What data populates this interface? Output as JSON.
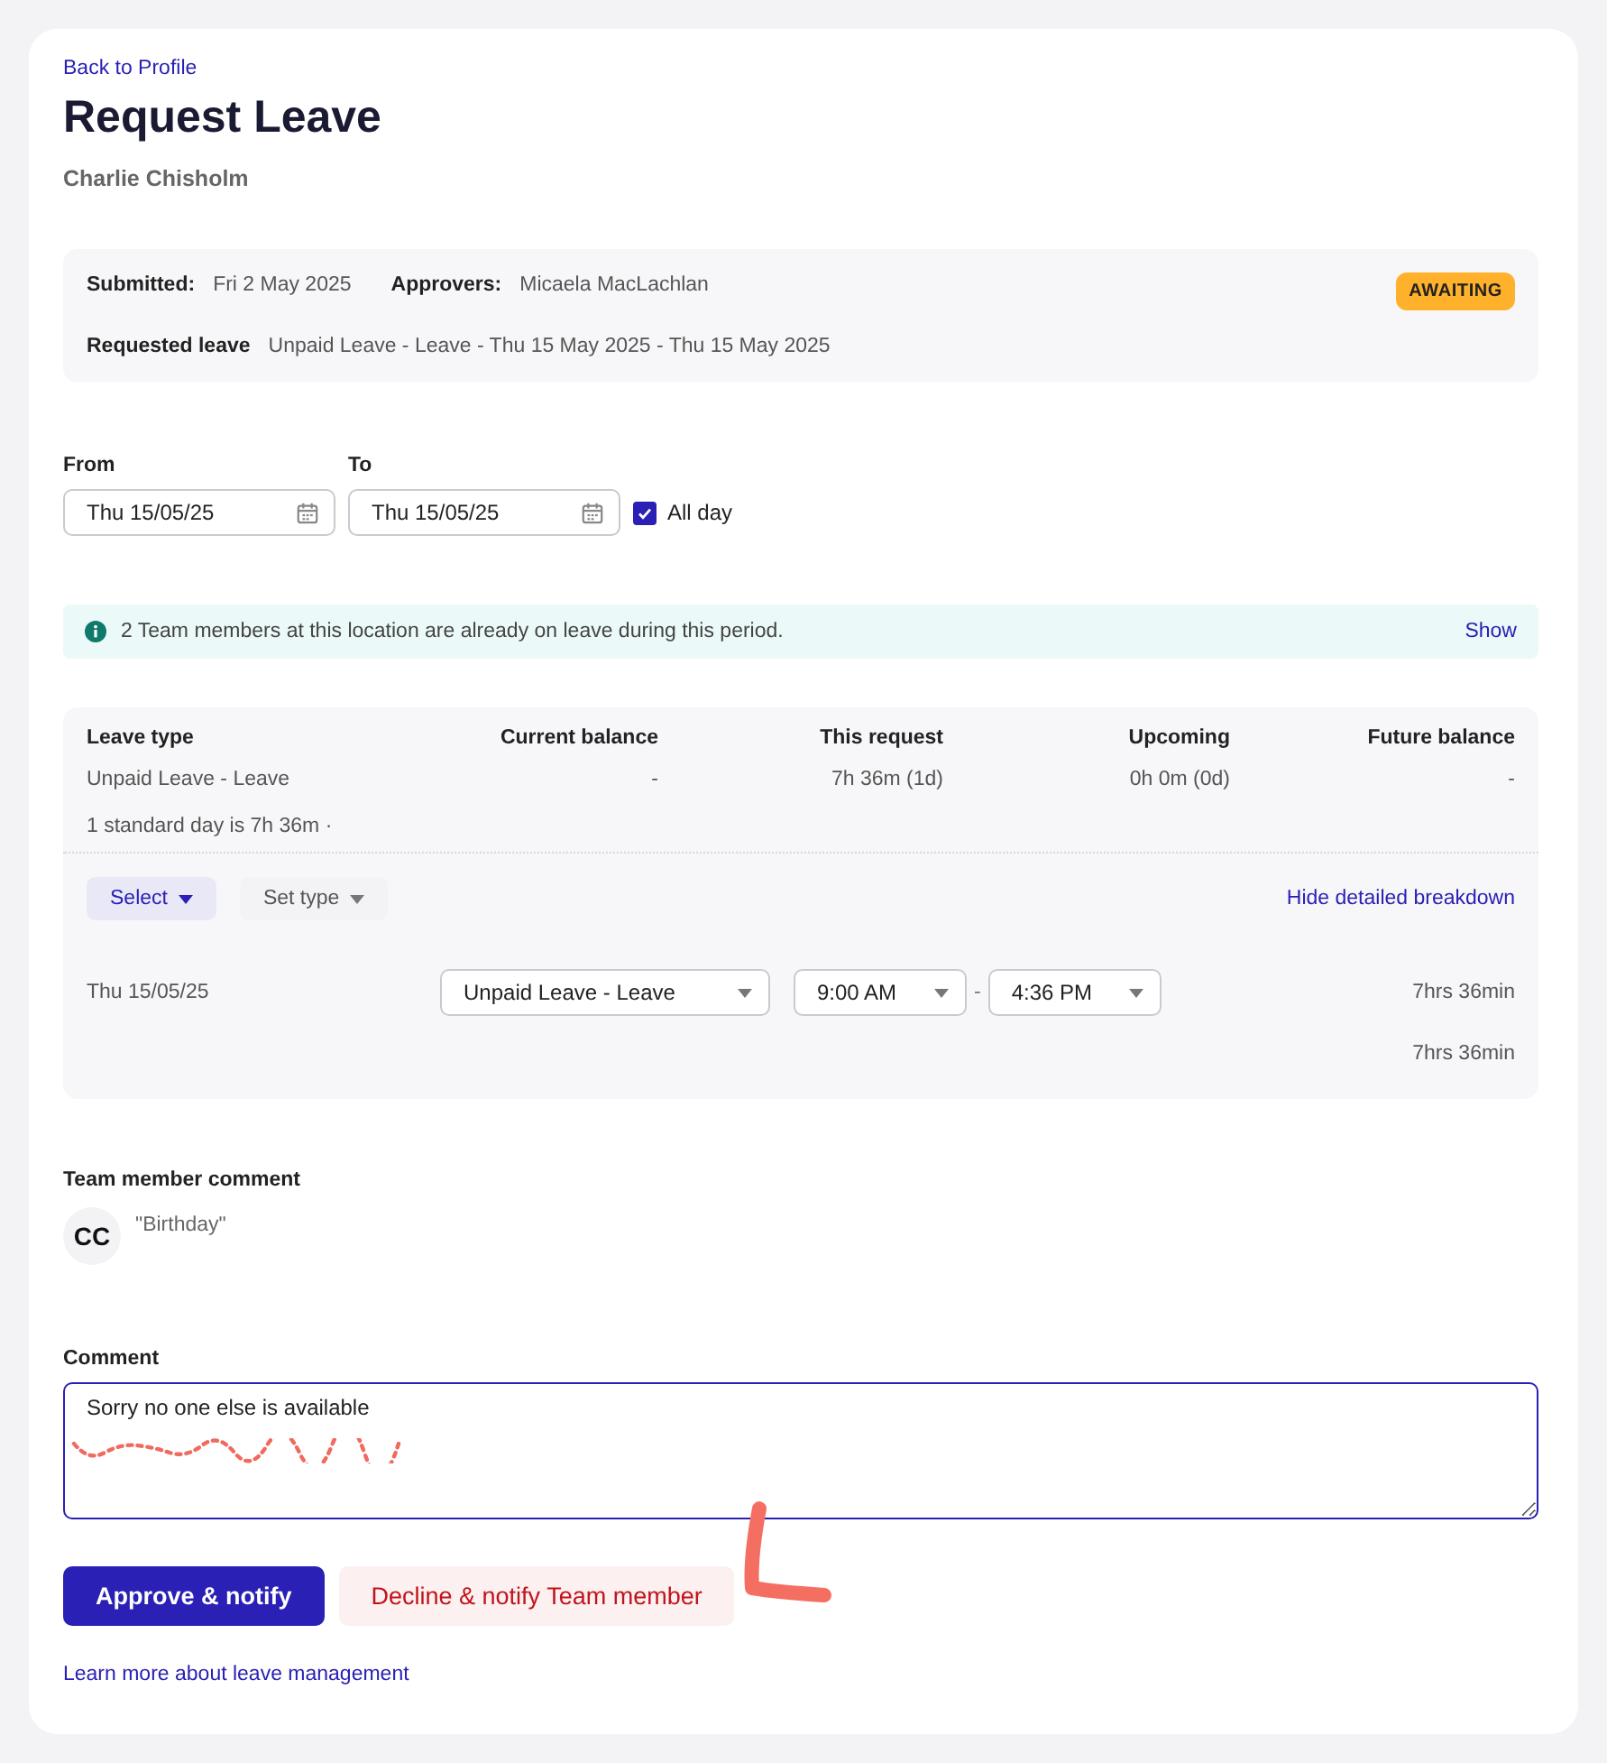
{
  "back_link": "Back to Profile",
  "title": "Request Leave",
  "employee": "Charlie Chisholm",
  "summary": {
    "fields": [
      {
        "label": "Submitted:",
        "value": "Fri 2 May 2025"
      },
      {
        "label": "Approvers:",
        "value": "Micaela MacLachlan"
      }
    ],
    "status": "AWAITING",
    "requested": {
      "label": "Requested leave",
      "value": "Unpaid Leave - Leave - Thu 15 May 2025 - Thu 15 May 2025"
    }
  },
  "dates": {
    "from": {
      "label": "From",
      "value": "Thu 15/05/25"
    },
    "to": {
      "label": "To",
      "value": "Thu 15/05/25"
    },
    "all_day": {
      "label": "All day",
      "checked": true
    }
  },
  "notice": {
    "text": "2 Team members at this location are already on leave during this period.",
    "action": "Show"
  },
  "breakdown": {
    "columns": [
      "Leave type",
      "Current balance",
      "This request",
      "Upcoming",
      "Future balance"
    ],
    "row": [
      "Unpaid Leave - Leave",
      "-",
      "7h 36m (1d)",
      "0h 0m (0d)",
      "-"
    ],
    "note": "1 standard day is 7h 36m ·",
    "select_button": "Select",
    "set_type_button": "Set type",
    "toggle_link": "Hide detailed breakdown",
    "days": [
      {
        "date": "Thu 15/05/25",
        "leave_type": "Unpaid Leave - Leave",
        "start": "9:00 AM",
        "separator": "-",
        "end": "4:36 PM",
        "duration": "7hrs 36min"
      }
    ],
    "total": "7hrs 36min"
  },
  "team_comment": {
    "label": "Team member comment",
    "initials": "CC",
    "text": "\"Birthday\""
  },
  "comment": {
    "label": "Comment",
    "value": "Sorry no one else is available"
  },
  "buttons": {
    "approve": "Approve & notify",
    "decline": "Decline & notify Team member"
  },
  "help_link": "Learn more about leave management"
}
